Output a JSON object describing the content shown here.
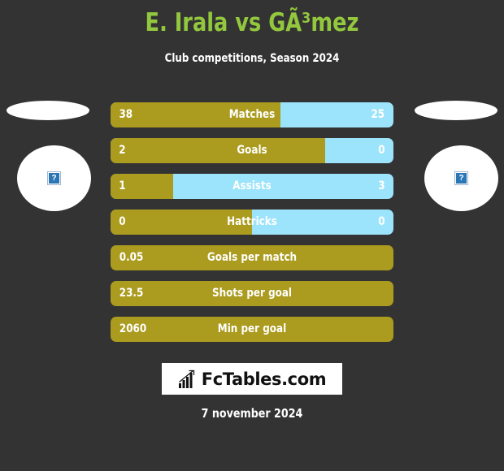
{
  "header": {
    "title": "E. Irala vs GÃ³mez",
    "subtitle": "Club competitions, Season 2024"
  },
  "colors": {
    "background": "#333333",
    "title_green": "#93c83e",
    "home_gold": "#ab9b1e",
    "away_blue": "#9ce4fb",
    "text_white": "#ffffff"
  },
  "players": {
    "left": {
      "photo_alt": "?"
    },
    "right": {
      "photo_alt": "?"
    }
  },
  "chart_data": {
    "type": "bar",
    "title": "E. Irala vs GÃ³mez",
    "subtitle": "Club competitions, Season 2024",
    "orientation": "horizontal-stacked",
    "series": [
      {
        "name": "E. Irala",
        "color": "#ab9b1e"
      },
      {
        "name": "GÃ³mez",
        "color": "#9ce4fb"
      }
    ],
    "categories": [
      "Matches",
      "Goals",
      "Assists",
      "Hattricks",
      "Goals per match",
      "Shots per goal",
      "Min per goal"
    ],
    "rows": [
      {
        "label": "Matches",
        "left_value": "38",
        "right_value": "25",
        "left_pct": 60,
        "single": false
      },
      {
        "label": "Goals",
        "left_value": "2",
        "right_value": "0",
        "left_pct": 76,
        "single": false
      },
      {
        "label": "Assists",
        "left_value": "1",
        "right_value": "3",
        "left_pct": 22,
        "single": false
      },
      {
        "label": "Hattricks",
        "left_value": "0",
        "right_value": "0",
        "left_pct": 50,
        "single": false
      },
      {
        "label": "Goals per match",
        "left_value": "0.05",
        "right_value": "",
        "left_pct": 100,
        "single": true
      },
      {
        "label": "Shots per goal",
        "left_value": "23.5",
        "right_value": "",
        "left_pct": 100,
        "single": true
      },
      {
        "label": "Min per goal",
        "left_value": "2060",
        "right_value": "",
        "left_pct": 100,
        "single": true
      }
    ]
  },
  "footer": {
    "logo_text": "FcTables.com",
    "logo_icon": "bar-chart-growth-icon",
    "date": "7 november 2024"
  }
}
